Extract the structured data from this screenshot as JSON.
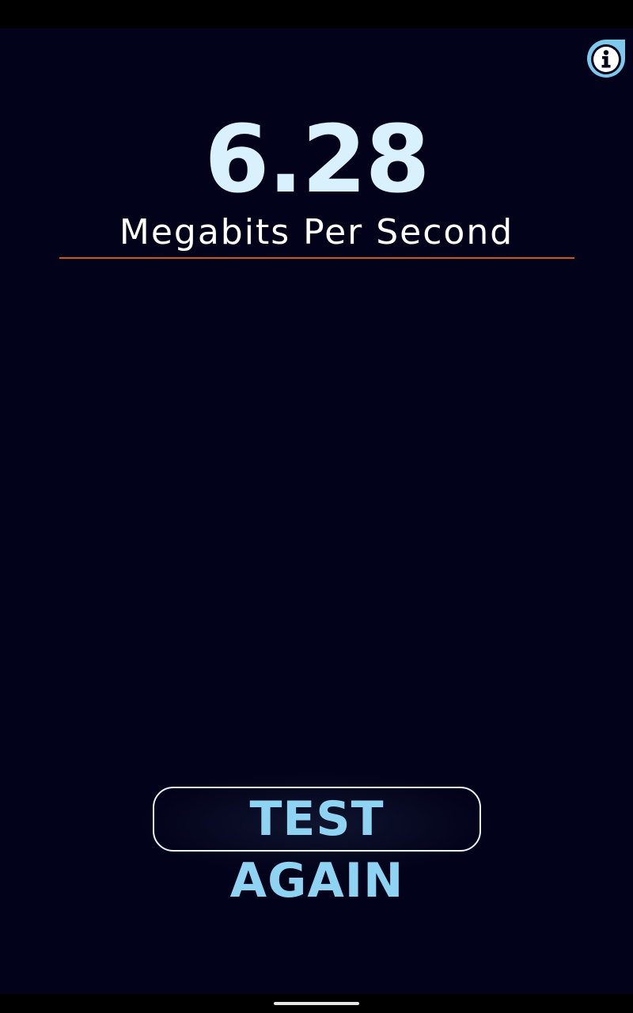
{
  "result": {
    "speed_value": "6.28",
    "speed_unit": "Megabits Per Second"
  },
  "actions": {
    "test_again_label": "TEST AGAIN"
  },
  "icons": {
    "info": "info-icon"
  },
  "colors": {
    "background": "#02031a",
    "speed_value": "#d9f1fd",
    "unit_text": "#ffffff",
    "divider": "#d4521f",
    "button_text": "#8fd3f2",
    "button_border": "#e8f3fb",
    "info_icon_ring": "#7ec8ec"
  }
}
